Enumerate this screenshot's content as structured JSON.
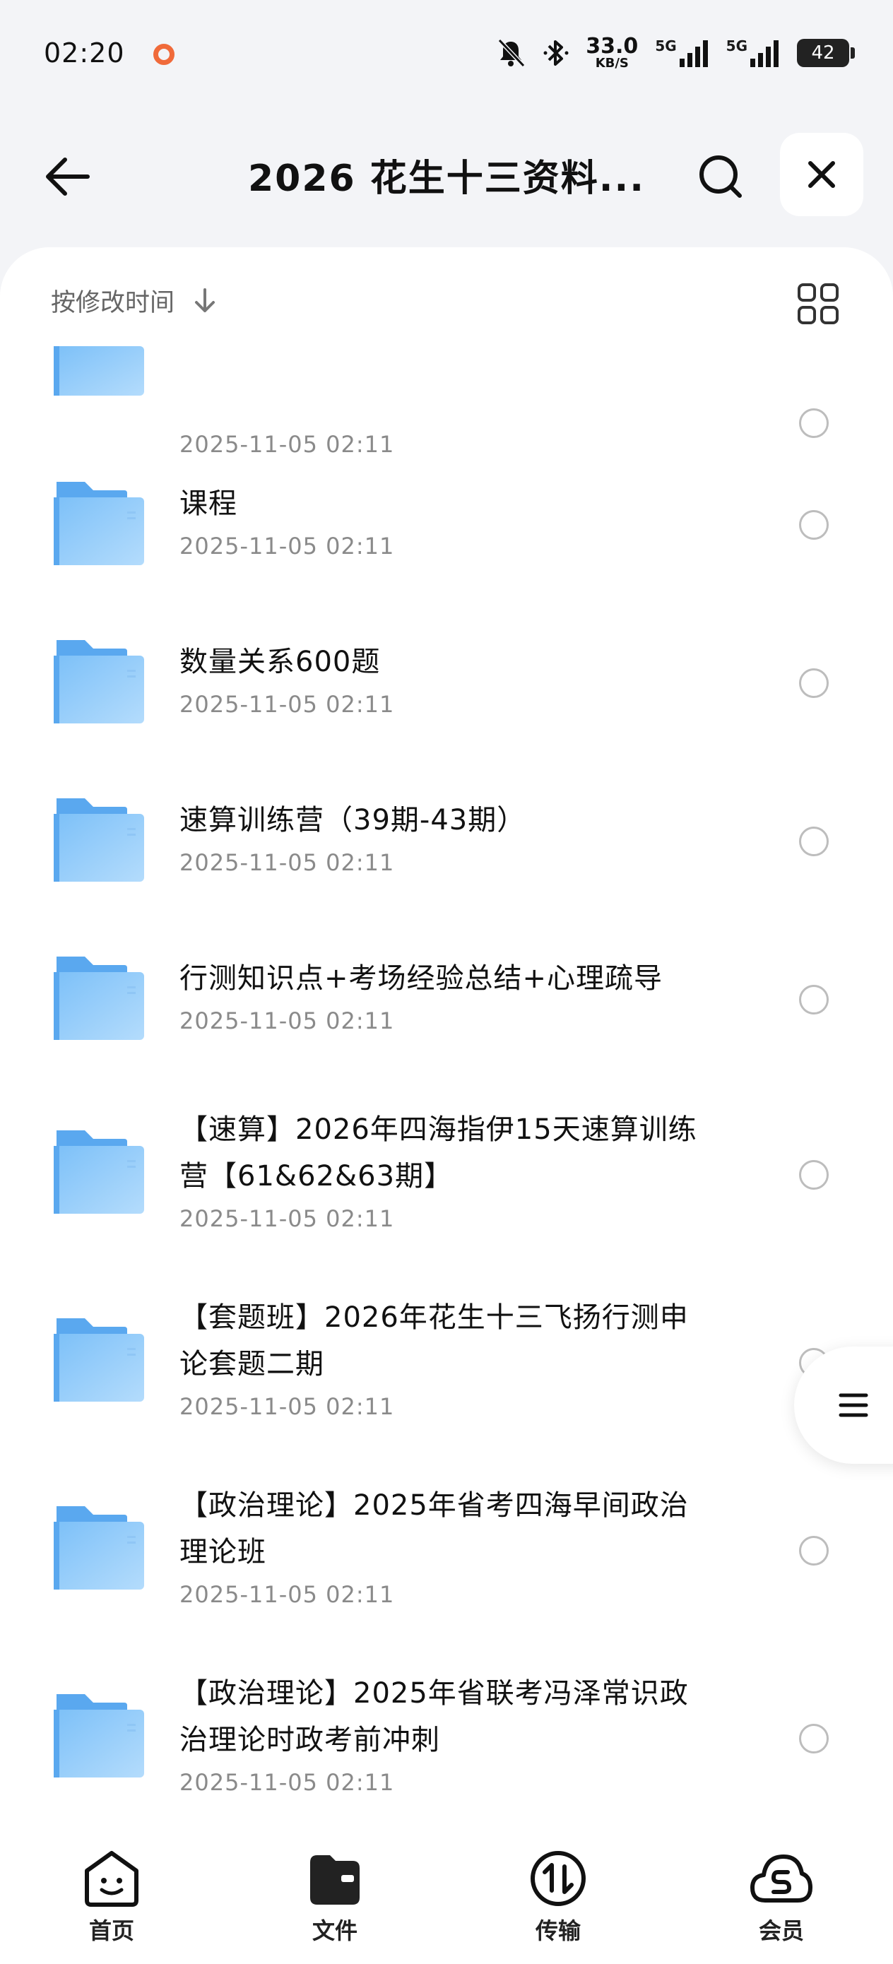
{
  "status": {
    "time": "02:20",
    "net_speed": "33.0",
    "net_unit": "KB/S",
    "battery": "42",
    "signal_1": "5G",
    "signal_2": "5G"
  },
  "header": {
    "title": "2026 花生十三资料..."
  },
  "sort": {
    "label": "按修改时间"
  },
  "folders": [
    {
      "name": "",
      "date": "2025-11-05 02:11"
    },
    {
      "name": "课程",
      "date": "2025-11-05 02:11"
    },
    {
      "name": "数量关系600题",
      "date": "2025-11-05 02:11"
    },
    {
      "name": "速算训练营（39期-43期）",
      "date": "2025-11-05 02:11"
    },
    {
      "name": "行测知识点+考场经验总结+心理疏导",
      "date": "2025-11-05 02:11"
    },
    {
      "name": "【速算】2026年四海指伊15天速算训练营【61&62&63期】",
      "date": "2025-11-05 02:11"
    },
    {
      "name": "【套题班】2026年花生十三飞扬行测申论套题二期",
      "date": "2025-11-05 02:11"
    },
    {
      "name": "【政治理论】2025年省考四海早间政治理论班",
      "date": "2025-11-05 02:11"
    },
    {
      "name": "【政治理论】2025年省联考冯泽常识政治理论时政考前冲刺",
      "date": "2025-11-05 02:11"
    }
  ],
  "nav": {
    "home": "首页",
    "files": "文件",
    "transfer": "传输",
    "vip": "会员"
  },
  "colors": {
    "folder": "#6cb4f5",
    "folder_light": "#a6d4fb",
    "accent": "#1a1a1a"
  }
}
